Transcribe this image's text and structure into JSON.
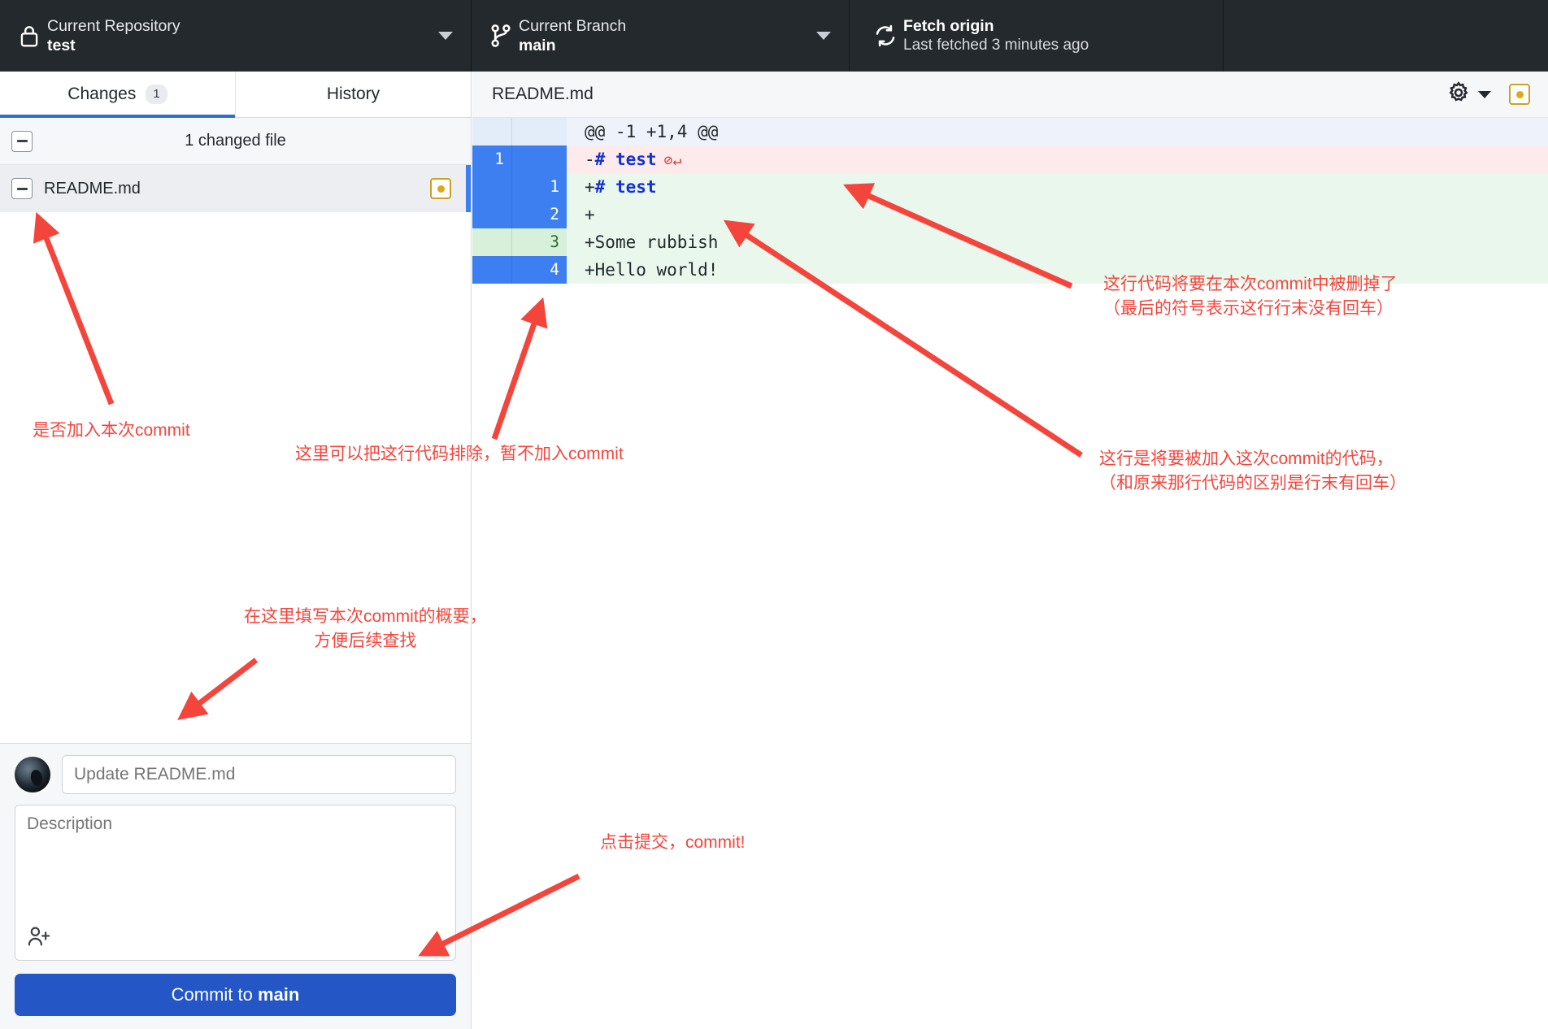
{
  "toolbar": {
    "repo": {
      "label": "Current Repository",
      "value": "test",
      "icon": "lock-icon"
    },
    "branch": {
      "label": "Current Branch",
      "value": "main",
      "icon": "branch-icon"
    },
    "fetch": {
      "title": "Fetch origin",
      "subtitle": "Last fetched 3 minutes ago",
      "icon": "sync-icon"
    }
  },
  "sidebar": {
    "tabs": [
      {
        "label": "Changes",
        "badge": "1",
        "active": true
      },
      {
        "label": "History",
        "badge": "",
        "active": false
      }
    ],
    "changed_summary": "1 changed file",
    "files": [
      {
        "name": "README.md",
        "status": "modified",
        "checked": "partial"
      }
    ]
  },
  "commit_form": {
    "summary_placeholder": "Update README.md",
    "summary_value": "",
    "description_placeholder": "Description",
    "description_value": "",
    "coauthor_icon": "add-person-icon",
    "button_prefix": "Commit to ",
    "button_branch": "main"
  },
  "diff": {
    "file_name": "README.md",
    "gear_icon": "gear-icon",
    "status_icon": "modified-status-icon",
    "hunk_header": "@@ -1 +1,4 @@",
    "lines": [
      {
        "kind": "hunk",
        "old": "",
        "new": "",
        "text": "@@ -1 +1,4 @@",
        "selected": false
      },
      {
        "kind": "del",
        "old": "1",
        "new": "",
        "prefix": "-",
        "code": "# test",
        "md_heading": true,
        "no_newline": true,
        "selected": true
      },
      {
        "kind": "add",
        "old": "",
        "new": "1",
        "prefix": "+",
        "code": "# test",
        "md_heading": true,
        "no_newline": false,
        "selected": true
      },
      {
        "kind": "add",
        "old": "",
        "new": "2",
        "prefix": "+",
        "code": "",
        "md_heading": false,
        "no_newline": false,
        "selected": true
      },
      {
        "kind": "add",
        "old": "",
        "new": "3",
        "prefix": "+",
        "code": "Some rubbish",
        "md_heading": false,
        "no_newline": false,
        "selected": false
      },
      {
        "kind": "add",
        "old": "",
        "new": "4",
        "prefix": "+",
        "code": "Hello world!",
        "md_heading": false,
        "no_newline": false,
        "selected": true
      }
    ]
  },
  "annotations": [
    {
      "id": "anno-include-in-commit",
      "text": "是否加入本次commit"
    },
    {
      "id": "anno-exclude-line",
      "text": "这里可以把这行代码排除，暂不加入commit"
    },
    {
      "id": "anno-line-deleted",
      "text": "这行代码将要在本次commit中被删掉了\n（最后的符号表示这行行末没有回车）"
    },
    {
      "id": "anno-line-added",
      "text": "这行是将要被加入这次commit的代码，\n（和原来那行代码的区别是行末有回车）"
    },
    {
      "id": "anno-summary-hint",
      "text": "在这里填写本次commit的概要，\n方便后续查找"
    },
    {
      "id": "anno-commit-click",
      "text": "点击提交，commit!"
    }
  ],
  "colors": {
    "toolbar_bg": "#24292e",
    "accent_blue": "#3d7ff0",
    "commit_button": "#2456c5",
    "annotation_red": "#f4453c",
    "add_bg": "#e9f7ec",
    "del_bg": "#fdeaea",
    "status_yellow": "#dfa915"
  }
}
